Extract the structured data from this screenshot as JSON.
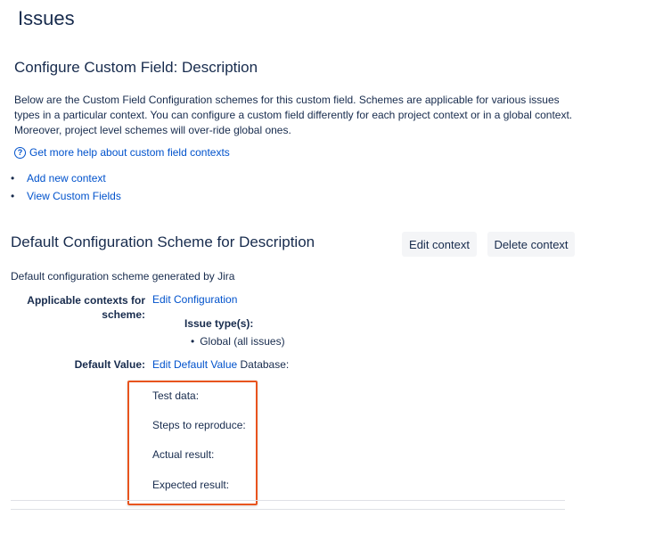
{
  "page_title": "Issues",
  "section_title": "Configure Custom Field: Description",
  "description_text": "Below are the Custom Field Configuration schemes for this custom field. Schemes are applicable for various issues types in a particular context. You can configure a custom field differently for each project context or in a global context. Moreover, project level schemes will over-ride global ones.",
  "help_link": "Get more help about custom field contexts",
  "links": [
    "Add new context",
    "View Custom Fields"
  ],
  "scheme": {
    "title": "Default Configuration Scheme for Description",
    "edit_context_label": "Edit context",
    "delete_context_label": "Delete context",
    "generated_text": "Default configuration scheme generated by Jira",
    "applicable_label_line1": "Applicable contexts for",
    "applicable_label_line2": "scheme:",
    "edit_configuration": "Edit Configuration",
    "issue_types_label": "Issue type(s):",
    "issue_types": [
      "Global (all issues)"
    ],
    "default_value_label": "Default Value:",
    "edit_default_value": "Edit Default Value",
    "default_value_prefix": "Database:",
    "default_value_lines": [
      "Test data:",
      "Steps to reproduce:",
      "Actual result:",
      "Expected result:"
    ]
  },
  "colors": {
    "link": "#0052cc",
    "highlight_box": "#e8541e",
    "button_bg": "#f4f5f7"
  }
}
